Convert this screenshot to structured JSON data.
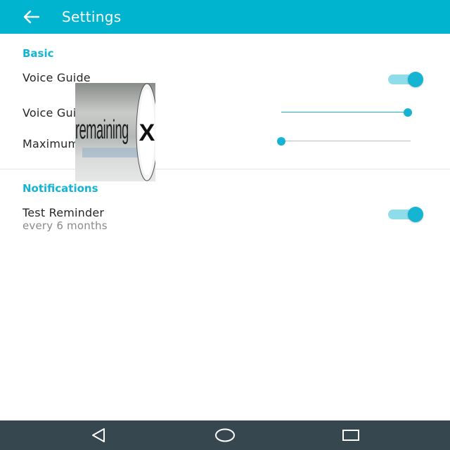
{
  "appbar": {
    "title": "Settings",
    "back_icon": "arrow-left-icon"
  },
  "sections": {
    "basic": {
      "title": "Basic",
      "voice_guide": {
        "label": "Voice Guide",
        "enabled": true
      },
      "voice_volume": {
        "label": "Voice Guide Volume",
        "level": 0.98
      },
      "max_brightness": {
        "label": "Maximum Brightness",
        "level": 0.0
      }
    },
    "notifications": {
      "title": "Notifications",
      "test_reminder": {
        "label": "Test Reminder",
        "subtitle": "every 6 months",
        "enabled": true
      }
    }
  },
  "overlay_ad": {
    "text": "remaining",
    "close_glyph": "X"
  },
  "navbar": {
    "back_icon": "nav-back-triangle-icon",
    "home_icon": "nav-home-circle-icon",
    "recents_icon": "nav-recents-square-icon"
  },
  "colors": {
    "appbar": "#00b4d0",
    "accent": "#14b4d2",
    "navbar": "#37474f"
  }
}
